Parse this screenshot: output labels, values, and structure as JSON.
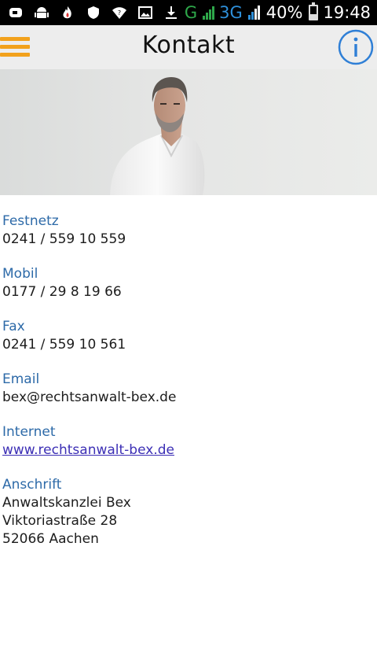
{
  "status_bar": {
    "network_g": "G",
    "network_3g": "3G",
    "battery_percent": "40%",
    "battery_level": 0.4,
    "time": "19:48",
    "left_icons": [
      "notification-icon",
      "android-icon",
      "flame-icon",
      "shield-icon",
      "wifi-question-icon",
      "image-icon",
      "download-icon"
    ]
  },
  "app_bar": {
    "title": "Kontakt",
    "menu_color": "#f2a11c",
    "info_color": "#2f7fd6"
  },
  "contact": {
    "festnetz": {
      "label": "Festnetz",
      "value": "0241 / 559 10 559"
    },
    "mobil": {
      "label": "Mobil",
      "value": "0177 / 29 8 19 66"
    },
    "fax": {
      "label": "Fax",
      "value": "0241 / 559 10 561"
    },
    "email": {
      "label": "Email",
      "value": "bex@rechtsanwalt-bex.de"
    },
    "internet": {
      "label": "Internet",
      "value": "www.rechtsanwalt-bex.de"
    },
    "anschrift": {
      "label": "Anschrift",
      "lines": [
        "Anwaltskanzlei Bex",
        "Viktoriastraße 28",
        "52066 Aachen"
      ]
    }
  },
  "colors": {
    "label": "#2d6aa8",
    "link": "#3c2fb5",
    "appbar_bg": "#ededed"
  }
}
